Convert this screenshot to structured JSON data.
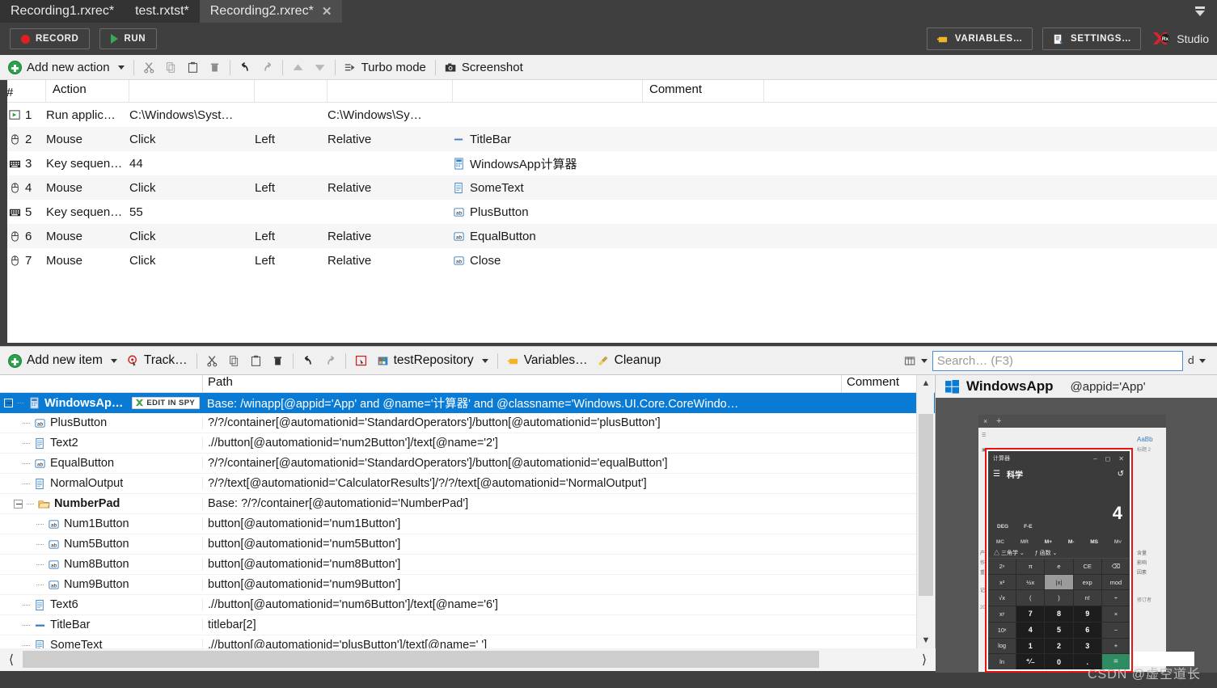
{
  "tabs": [
    {
      "label": "Recording1.rxrec*",
      "active": false
    },
    {
      "label": "test.rxtst*",
      "active": false
    },
    {
      "label": "Recording2.rxrec*",
      "active": true,
      "close": "✕"
    }
  ],
  "commandbar": {
    "record_label": "RECORD",
    "run_label": "RUN",
    "variables_label": "VARIABLES…",
    "settings_label": "SETTINGS…",
    "studio_label": "Studio",
    "studio_mark": "Rx"
  },
  "action_toolbar": {
    "add_new_action": "Add new action",
    "turbo_mode": "Turbo mode",
    "screenshot": "Screenshot",
    "icons": [
      "cut-icon",
      "copy-icon",
      "paste-icon",
      "delete-icon",
      "undo-icon",
      "redo-icon",
      "move-up-icon",
      "move-down-icon"
    ]
  },
  "action_table": {
    "headers": [
      "#",
      "Action",
      "",
      "",
      "",
      "",
      "Comment"
    ],
    "rows": [
      {
        "icon": "run-application-icon",
        "index": "1",
        "action": "Run applic…",
        "p1": "C:\\Windows\\Syst…",
        "p2": "",
        "p3": "C:\\Windows\\Sy…",
        "obj_icon": "",
        "object": "",
        "comment": ""
      },
      {
        "icon": "mouse-icon",
        "index": "2",
        "action": "Mouse",
        "p1": "Click",
        "p2": "Left",
        "p3": "Relative",
        "obj_icon": "titlebar-icon",
        "object": "TitleBar",
        "comment": ""
      },
      {
        "icon": "keyboard-icon",
        "index": "3",
        "action": "Key sequen…",
        "p1": "44",
        "p2": "",
        "p3": "",
        "obj_icon": "app-icon",
        "object": "WindowsApp计算器",
        "comment": ""
      },
      {
        "icon": "mouse-icon",
        "index": "4",
        "action": "Mouse",
        "p1": "Click",
        "p2": "Left",
        "p3": "Relative",
        "obj_icon": "text-icon",
        "object": "SomeText",
        "comment": ""
      },
      {
        "icon": "keyboard-icon",
        "index": "5",
        "action": "Key sequen…",
        "p1": "55",
        "p2": "",
        "p3": "",
        "obj_icon": "ab-icon",
        "object": "PlusButton",
        "comment": ""
      },
      {
        "icon": "mouse-icon",
        "index": "6",
        "action": "Mouse",
        "p1": "Click",
        "p2": "Left",
        "p3": "Relative",
        "obj_icon": "ab-icon",
        "object": "EqualButton",
        "comment": ""
      },
      {
        "icon": "mouse-icon",
        "index": "7",
        "action": "Mouse",
        "p1": "Click",
        "p2": "Left",
        "p3": "Relative",
        "obj_icon": "ab-icon",
        "object": "Close",
        "comment": ""
      }
    ]
  },
  "repo_toolbar": {
    "add_new_item": "Add new item",
    "track": "Track…",
    "repository": "testRepository",
    "variables": "Variables…",
    "cleanup": "Cleanup",
    "search_placeholder": "Search… (F3)",
    "search_value": ""
  },
  "repo": {
    "headers": {
      "name": "",
      "path": "Path",
      "comment": "Comment"
    },
    "rows": [
      {
        "name": "WindowsAp…",
        "path": "Base: /winapp[@appid='App' and @name='计算器' and @classname='Windows.UI.Core.CoreWindo…",
        "icon": "app-icon",
        "depth": 0,
        "selected": true,
        "bold": true,
        "expander": true,
        "badge": "EDIT IN SPY"
      },
      {
        "name": "PlusButton",
        "path": "?/?/container[@automationid='StandardOperators']/button[@automationid='plusButton']",
        "icon": "ab-icon",
        "depth": 1,
        "selected": false,
        "bold": false,
        "expander": false
      },
      {
        "name": "Text2",
        "path": ".//button[@automationid='num2Button']/text[@name='2']",
        "icon": "text-icon",
        "depth": 1,
        "selected": false,
        "bold": false,
        "expander": false
      },
      {
        "name": "EqualButton",
        "path": "?/?/container[@automationid='StandardOperators']/button[@automationid='equalButton']",
        "icon": "ab-icon",
        "depth": 1,
        "selected": false,
        "bold": false,
        "expander": false
      },
      {
        "name": "NormalOutput",
        "path": "?/?/text[@automationid='CalculatorResults']/?/?/text[@automationid='NormalOutput']",
        "icon": "text-icon",
        "depth": 1,
        "selected": false,
        "bold": false,
        "expander": false
      },
      {
        "name": "NumberPad",
        "path": "Base: ?/?/container[@automationid='NumberPad']",
        "icon": "folder-icon",
        "depth": 1,
        "selected": false,
        "bold": true,
        "expander": true
      },
      {
        "name": "Num1Button",
        "path": "button[@automationid='num1Button']",
        "icon": "ab-icon",
        "depth": 2,
        "selected": false,
        "bold": false,
        "expander": false
      },
      {
        "name": "Num5Button",
        "path": "button[@automationid='num5Button']",
        "icon": "ab-icon",
        "depth": 2,
        "selected": false,
        "bold": false,
        "expander": false
      },
      {
        "name": "Num8Button",
        "path": "button[@automationid='num8Button']",
        "icon": "ab-icon",
        "depth": 2,
        "selected": false,
        "bold": false,
        "expander": false
      },
      {
        "name": "Num9Button",
        "path": "button[@automationid='num9Button']",
        "icon": "ab-icon",
        "depth": 2,
        "selected": false,
        "bold": false,
        "expander": false
      },
      {
        "name": "Text6",
        "path": ".//button[@automationid='num6Button']/text[@name='6']",
        "icon": "text-icon",
        "depth": 1,
        "selected": false,
        "bold": false,
        "expander": false
      },
      {
        "name": "TitleBar",
        "path": "titlebar[2]",
        "icon": "titlebar-icon",
        "depth": 1,
        "selected": false,
        "bold": false,
        "expander": false
      },
      {
        "name": "SomeText",
        "path": ".//button[@automationid='plusButton']/text[@name='  ']",
        "icon": "text-icon",
        "depth": 1,
        "selected": false,
        "bold": false,
        "expander": false
      }
    ]
  },
  "preview": {
    "title": "WindowsApp",
    "appid": "@appid='App'",
    "calculator": {
      "window_title": "计算器",
      "mode": "科学",
      "display": "4",
      "angle_unit": "DEG",
      "fe": "F-E",
      "memory": [
        "MC",
        "MR",
        "M+",
        "M-",
        "MS",
        "M˅"
      ],
      "func_menus": [
        "三角学",
        "函数"
      ],
      "keys": [
        "2ⁿ",
        "π",
        "e",
        "CE",
        "⌫",
        "x²",
        "½x",
        "|x|",
        "exp",
        "mod",
        "√x",
        "(",
        ")",
        "n!",
        "÷",
        "xʸ",
        "7",
        "8",
        "9",
        "×",
        "10ˣ",
        "4",
        "5",
        "6",
        "−",
        "log",
        "1",
        "2",
        "3",
        "+",
        "ln",
        "⁺⁄₋",
        "0",
        ".",
        "="
      ]
    }
  },
  "watermark": "CSDN @虚空道长"
}
